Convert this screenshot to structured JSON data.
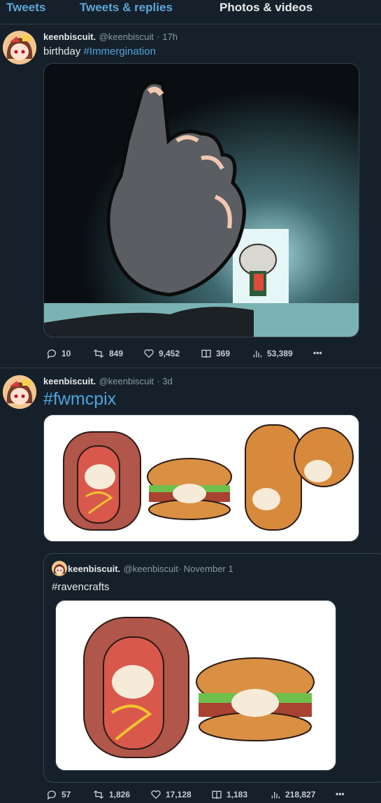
{
  "tabs": [
    {
      "label": "Tweets"
    },
    {
      "label": "Tweets & replies"
    },
    {
      "label": "Photos & videos"
    }
  ],
  "tweets": [
    {
      "name": "keenbiscuit.",
      "handle": "@keenbiscuit",
      "time": "· 17h",
      "text": "birthday",
      "hashtag": "#Immergination",
      "stats": {
        "replies": "10",
        "retweets": "849",
        "likes": "9,452",
        "bookmarks": "369",
        "views": "53,389"
      },
      "more": "•••"
    },
    {
      "name": "keenbiscuit.",
      "handle": "@keenbiscuit",
      "time": "· 3d",
      "hashtag": "#fwmcpix",
      "quote": {
        "name": "keenbiscuit.",
        "handle": "@keenbiscuit",
        "time": "· November 1",
        "text": "#ravencrafts"
      },
      "stats": {
        "replies": "57",
        "retweets": "1,826",
        "likes": "17,128",
        "bookmarks": "1,183",
        "views": "218,827"
      },
      "more": "•••"
    }
  ],
  "colors": {
    "background": "#15202b",
    "accent": "#4ea3dc",
    "muted": "#8b98a5"
  },
  "icons": [
    "avatar-icon",
    "reply-icon",
    "retweet-icon",
    "like-icon",
    "bookmark-icon",
    "views-icon",
    "more-icon"
  ]
}
